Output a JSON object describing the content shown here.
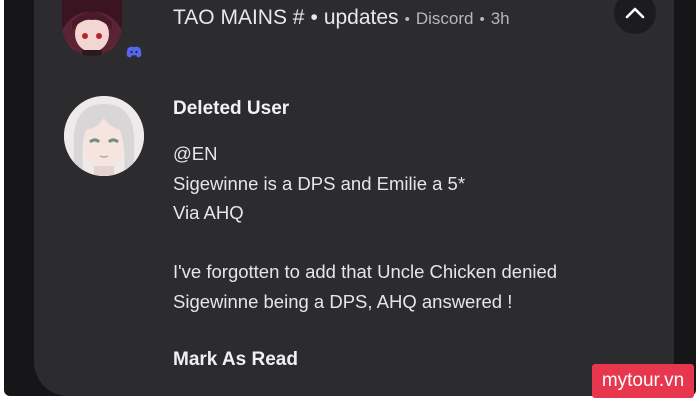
{
  "notification": {
    "title": "TAO MAINS #",
    "separator": "•",
    "channel": "updates",
    "small_separator": "•",
    "app": "Discord",
    "time": "3h"
  },
  "message": {
    "sender": "Deleted User",
    "lines": [
      "@EN",
      "Sigewinne is a DPS and Emilie a 5*",
      "Via AHQ",
      "",
      "I've forgotten to add that Uncle Chicken denied",
      "Sigewinne being a DPS, AHQ answered !"
    ]
  },
  "actions": {
    "mark_read": "Mark As Read"
  },
  "icons": {
    "header_avatar": "anime-character-avatar",
    "badge": "discord-icon",
    "collapse": "chevron-up-icon",
    "sender_avatar": "anime-character-avatar"
  },
  "colors": {
    "card": "#2c2c2e",
    "frame": "#161618",
    "text": "#e6e6e8",
    "discord": "#5865f2",
    "watermark": "#e8364e"
  },
  "watermark": {
    "text": "mytour.vn"
  }
}
